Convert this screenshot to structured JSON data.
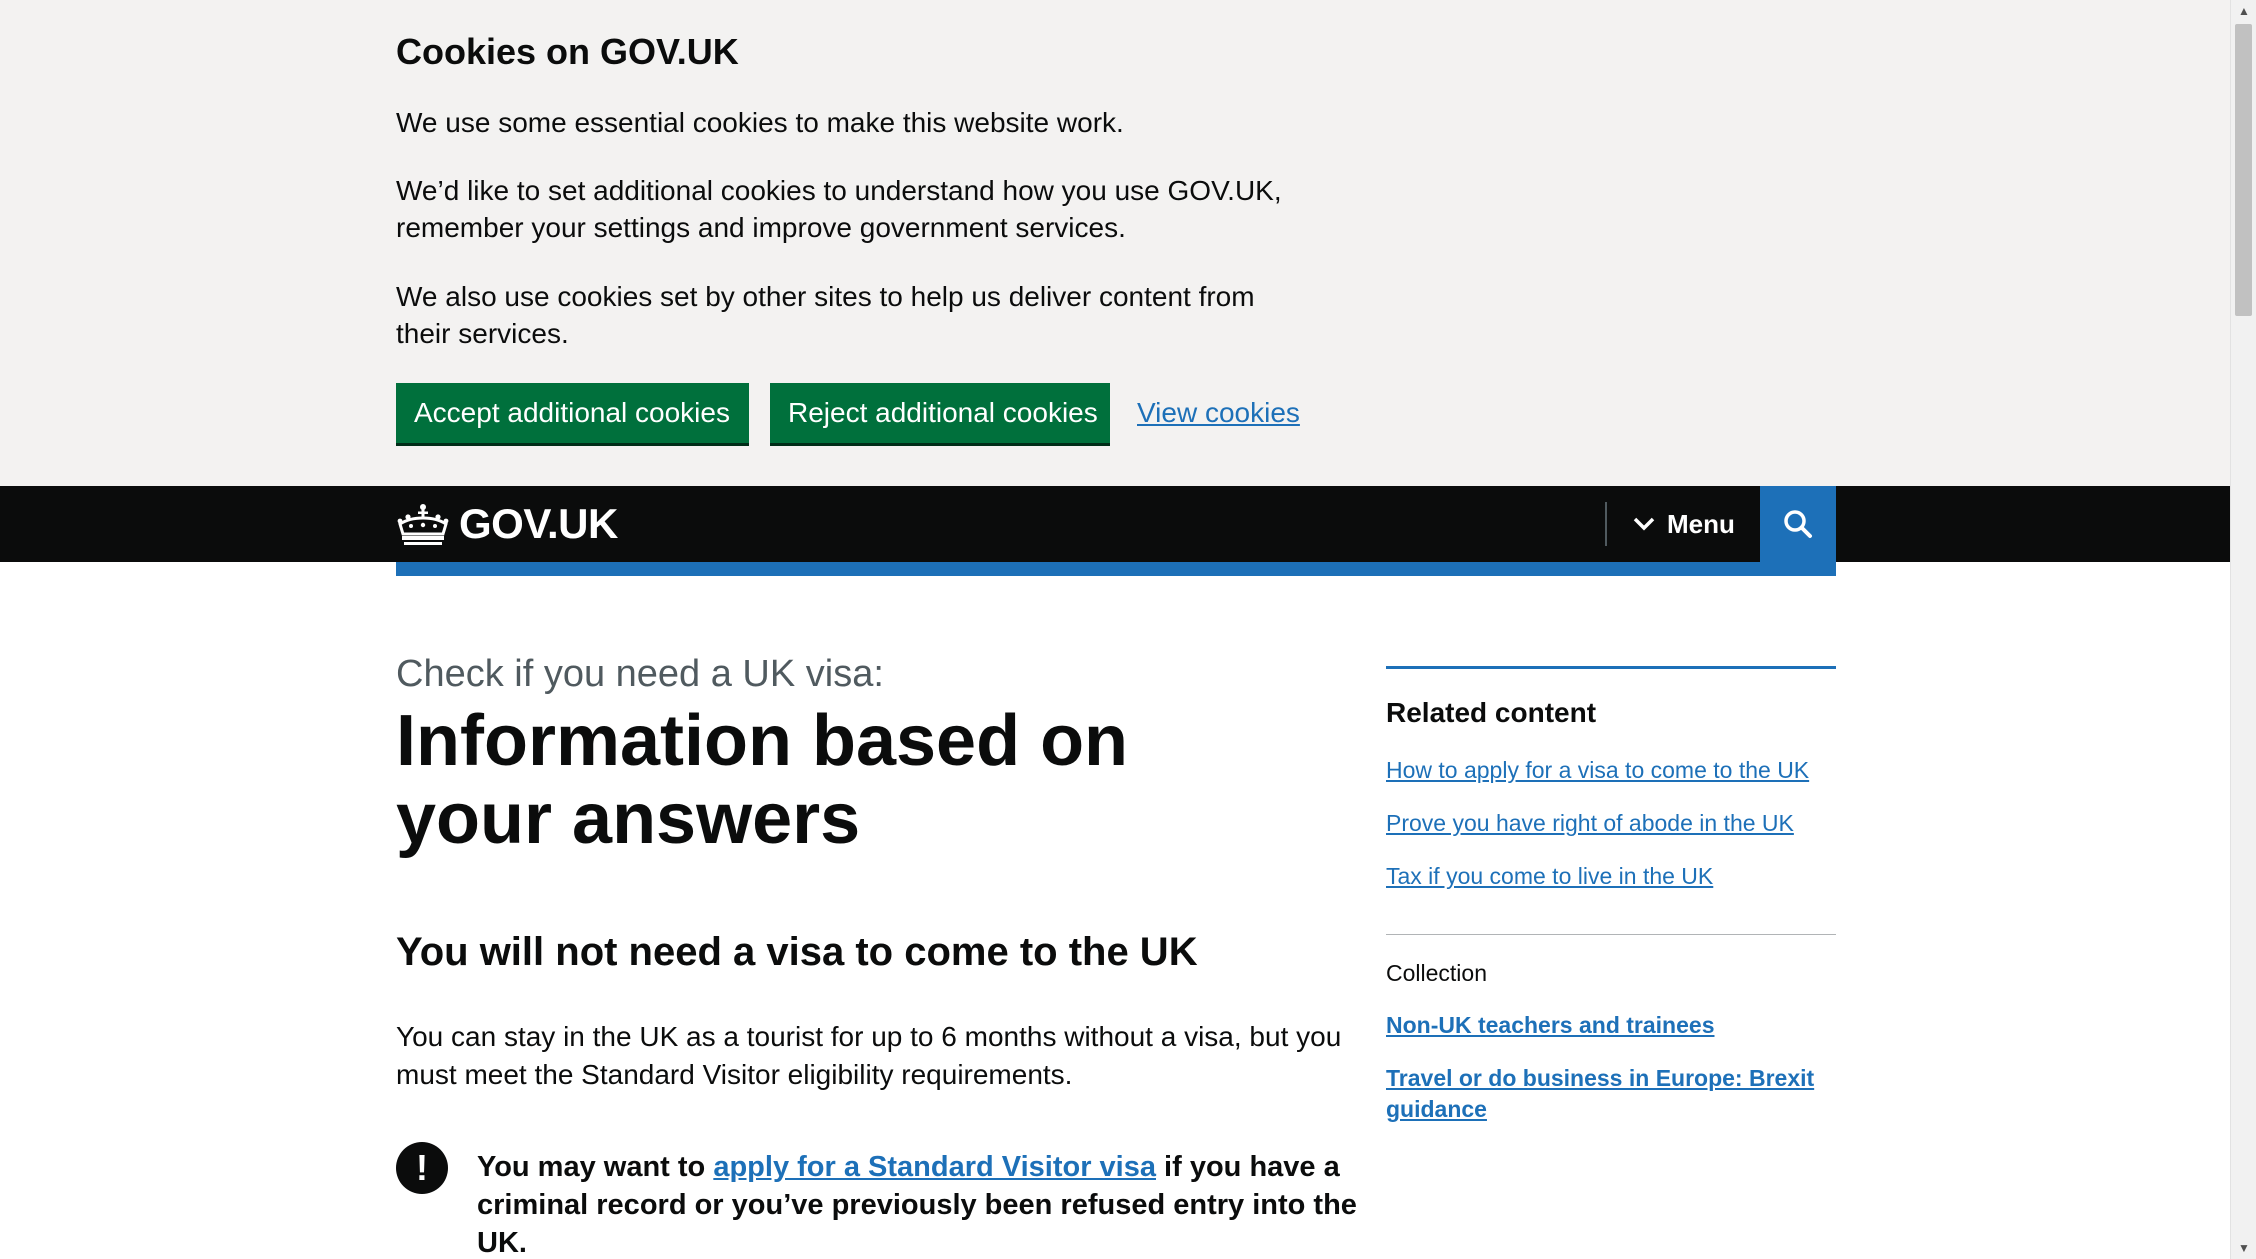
{
  "cookie_banner": {
    "title": "Cookies on GOV.UK",
    "paragraph_1": "We use some essential cookies to make this website work.",
    "paragraph_2": "We’d like to set additional cookies to understand how you use GOV.UK, remember your settings and improve government services.",
    "paragraph_3": "We also use cookies set by other sites to help us deliver content from their services.",
    "accept_label": "Accept additional cookies",
    "reject_label": "Reject additional cookies",
    "view_label": "View cookies"
  },
  "header": {
    "logo_text": "GOV.UK",
    "logo_icon": "crown-icon",
    "menu_label": "Menu",
    "menu_icon": "chevron-down-icon",
    "search_icon": "search-icon"
  },
  "main": {
    "caption": "Check if you need a UK visa:",
    "title": "Information based on your answers",
    "subheading": "You will not need a visa to come to the UK",
    "body": "You can stay in the UK as a tourist for up to 6 months without a visa, but you must meet the Standard Visitor eligibility requirements.",
    "warning": {
      "icon": "!",
      "text_before": "You may want to ",
      "link_text": "apply for a Standard Visitor visa",
      "text_after": " if you have a criminal record or you’ve previously been refused entry into the UK."
    }
  },
  "sidebar": {
    "related_title": "Related content",
    "related_links": [
      "How to apply for a visa to come to the UK",
      "Prove you have right of abode in the UK",
      "Tax if you come to live in the UK"
    ],
    "collection_label": "Collection",
    "collection_links": [
      "Non-UK teachers and trainees",
      "Travel or do business in Europe: Brexit guidance"
    ]
  },
  "colors": {
    "black": "#0b0c0c",
    "green_button": "#00703c",
    "link_blue": "#1d70b8",
    "banner_grey": "#f3f2f1",
    "secondary_text": "#505a5f"
  }
}
